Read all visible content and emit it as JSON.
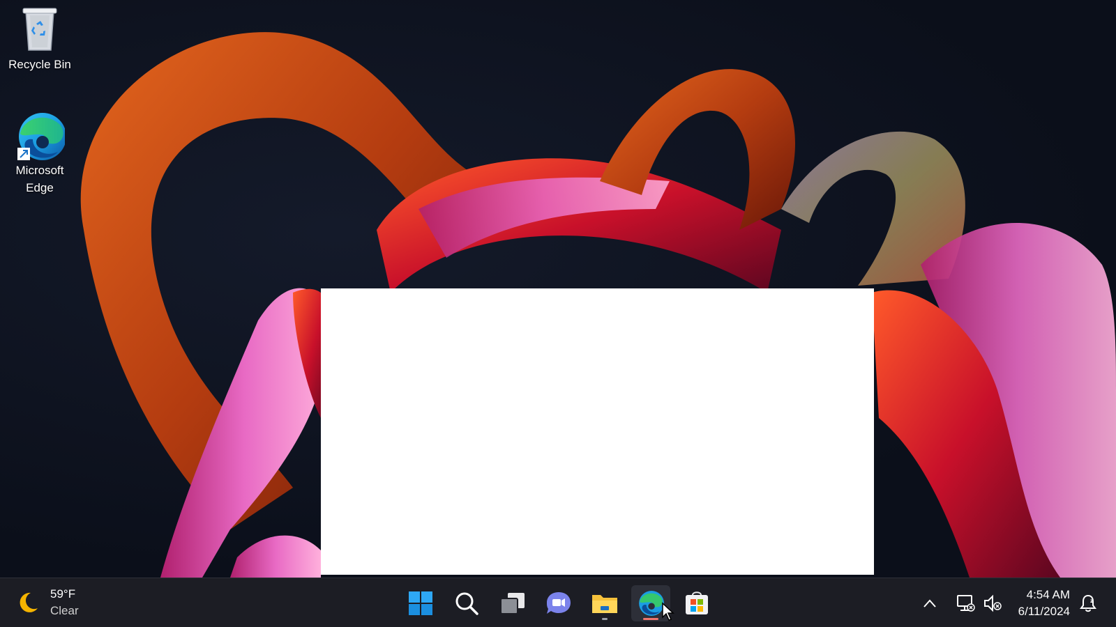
{
  "desktop": {
    "icons": [
      {
        "label": "Recycle Bin",
        "icon": "recycle-bin-icon"
      },
      {
        "label": "Microsoft Edge",
        "icon": "edge-icon"
      }
    ]
  },
  "taskbar": {
    "weather": {
      "temperature": "59°F",
      "condition": "Clear",
      "icon": "moon-icon"
    },
    "apps": [
      {
        "name": "Start",
        "icon": "windows-start-icon"
      },
      {
        "name": "Search",
        "icon": "search-icon"
      },
      {
        "name": "Task View",
        "icon": "task-view-icon"
      },
      {
        "name": "Chat",
        "icon": "chat-icon"
      },
      {
        "name": "File Explorer",
        "icon": "file-explorer-icon"
      },
      {
        "name": "Microsoft Edge",
        "icon": "edge-icon"
      },
      {
        "name": "Microsoft Store",
        "icon": "store-icon"
      }
    ],
    "tray": {
      "icons": [
        "chevron-up-icon",
        "network-icon",
        "volume-muted-icon",
        "notification-icon"
      ]
    },
    "clock": {
      "time": "4:54 AM",
      "date": "6/11/2024"
    }
  },
  "colors": {
    "taskbar": "#1c1d24",
    "accent_indicator": "#f0766e",
    "window": "#ffffff"
  }
}
